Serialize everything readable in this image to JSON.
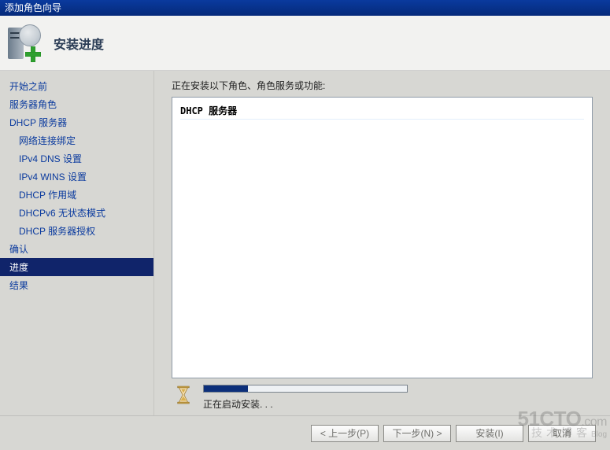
{
  "window": {
    "title": "添加角色向导"
  },
  "header": {
    "title": "安装进度"
  },
  "sidebar": {
    "items": [
      {
        "label": "开始之前",
        "sub": false,
        "selected": false
      },
      {
        "label": "服务器角色",
        "sub": false,
        "selected": false
      },
      {
        "label": "DHCP 服务器",
        "sub": false,
        "selected": false
      },
      {
        "label": "网络连接绑定",
        "sub": true,
        "selected": false
      },
      {
        "label": "IPv4 DNS 设置",
        "sub": true,
        "selected": false
      },
      {
        "label": "IPv4 WINS 设置",
        "sub": true,
        "selected": false
      },
      {
        "label": "DHCP 作用域",
        "sub": true,
        "selected": false
      },
      {
        "label": "DHCPv6 无状态模式",
        "sub": true,
        "selected": false
      },
      {
        "label": "DHCP 服务器授权",
        "sub": true,
        "selected": false
      },
      {
        "label": "确认",
        "sub": false,
        "selected": false
      },
      {
        "label": "进度",
        "sub": false,
        "selected": true
      },
      {
        "label": "结果",
        "sub": false,
        "selected": false
      }
    ]
  },
  "main": {
    "description": "正在安装以下角色、角色服务或功能:",
    "list": [
      "DHCP 服务器"
    ],
    "status_text": "正在启动安装. . ."
  },
  "buttons": {
    "prev": "< 上一步(P)",
    "next": "下一步(N) >",
    "install": "安装(I)",
    "cancel": "取消"
  },
  "watermark": {
    "brand": "51CTO",
    "suffix": ".com",
    "line2": "技术博客",
    "line2suffix": "Blog"
  }
}
